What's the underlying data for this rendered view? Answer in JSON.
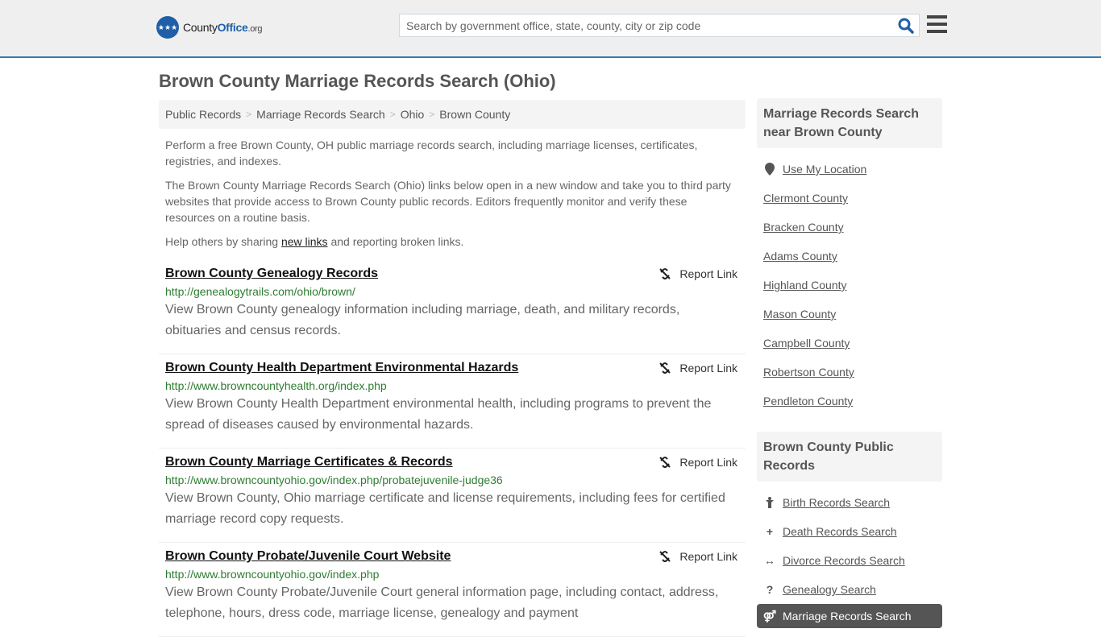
{
  "header": {
    "logo": {
      "badge_icon": "eagle-stars-icon",
      "name_part1": "County",
      "name_part2": "Office",
      "name_tld": ".org"
    },
    "search": {
      "placeholder": "Search by government office, state, county, city or zip code",
      "value": ""
    },
    "search_icon": "search-icon",
    "menu_icon": "hamburger-menu-icon"
  },
  "page_title": "Brown County Marriage Records Search (Ohio)",
  "breadcrumb": [
    "Public Records",
    "Marriage Records Search",
    "Ohio",
    "Brown County"
  ],
  "intro": {
    "p1": "Perform a free Brown County, OH public marriage records search, including marriage licenses, certificates, registries, and indexes.",
    "p2": "The Brown County Marriage Records Search (Ohio) links below open in a new window and take you to third party websites that provide access to Brown County public records. Editors frequently monitor and verify these resources on a routine basis.",
    "p3_before": "Help others by sharing ",
    "p3_link": "new links",
    "p3_after": " and reporting broken links."
  },
  "report_label": "Report Link",
  "results": [
    {
      "title": "Brown County Genealogy Records",
      "url": "http://genealogytrails.com/ohio/brown/",
      "description": "View Brown County genealogy information including marriage, death, and military records, obituaries and census records."
    },
    {
      "title": "Brown County Health Department Environmental Hazards",
      "url": "http://www.browncountyhealth.org/index.php",
      "description": "View Brown County Health Department environmental health, including programs to prevent the spread of diseases caused by environmental hazards."
    },
    {
      "title": "Brown County Marriage Certificates & Records",
      "url": "http://www.browncountyohio.gov/index.php/probatejuvenile-judge36",
      "description": "View Brown County, Ohio marriage certificate and license requirements, including fees for certified marriage record copy requests."
    },
    {
      "title": "Brown County Probate/Juvenile Court Website",
      "url": "http://www.browncountyohio.gov/index.php",
      "description": "View Brown County Probate/Juvenile Court general information page, including contact, address, telephone, hours, dress code, marriage license, genealogy and payment"
    }
  ],
  "sidebar": {
    "nearby": {
      "heading": "Marriage Records Search near Brown County",
      "use_location": "Use My Location",
      "counties": [
        "Clermont County",
        "Bracken County",
        "Adams County",
        "Highland County",
        "Mason County",
        "Campbell County",
        "Robertson County",
        "Pendleton County"
      ]
    },
    "public_records": {
      "heading": "Brown County Public Records",
      "items": [
        {
          "label": "Birth Records Search",
          "icon": "child-icon",
          "glyph": "♀"
        },
        {
          "label": "Death Records Search",
          "icon": "plus-icon",
          "glyph": "+"
        },
        {
          "label": "Divorce Records Search",
          "icon": "arrows-horizontal-icon",
          "glyph": "↔"
        },
        {
          "label": "Genealogy Search",
          "icon": "question-icon",
          "glyph": "?"
        },
        {
          "label": "Marriage Records Search",
          "icon": "gender-icon",
          "glyph": "⚤",
          "active": true
        }
      ]
    }
  }
}
